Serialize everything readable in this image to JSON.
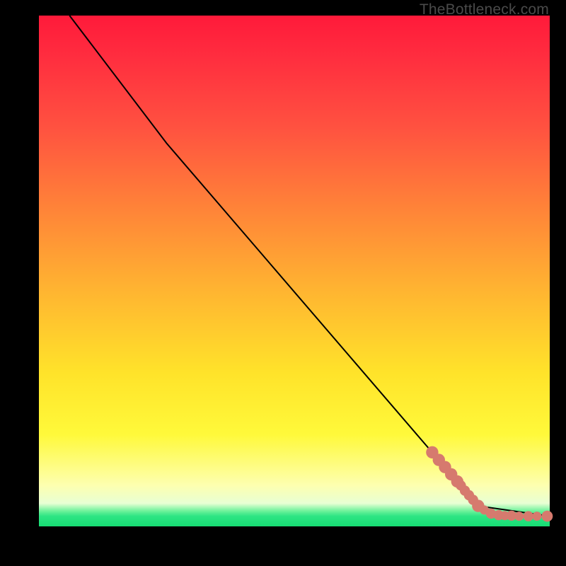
{
  "watermark": "TheBottleneck.com",
  "colors": {
    "gradient_top": "#ff1a3a",
    "gradient_mid": "#ffe32a",
    "gradient_bottom": "#17dd74",
    "curve": "#000000",
    "marker": "#d67a6e",
    "frame": "#000000"
  },
  "chart_data": {
    "type": "line",
    "title": "",
    "xlabel": "",
    "ylabel": "",
    "xlim": [
      0,
      100
    ],
    "ylim": [
      0,
      100
    ],
    "axes_visible": false,
    "curve": [
      {
        "x": 6,
        "y": 100
      },
      {
        "x": 25,
        "y": 75
      },
      {
        "x": 86,
        "y": 4
      },
      {
        "x": 100,
        "y": 2
      }
    ],
    "markers": [
      {
        "x": 77.0,
        "y": 14.5,
        "r": 1.2
      },
      {
        "x": 78.3,
        "y": 13.0,
        "r": 1.2
      },
      {
        "x": 79.5,
        "y": 11.6,
        "r": 1.2
      },
      {
        "x": 80.7,
        "y": 10.2,
        "r": 1.2
      },
      {
        "x": 81.9,
        "y": 8.8,
        "r": 1.2
      },
      {
        "x": 82.6,
        "y": 8.0,
        "r": 1.0
      },
      {
        "x": 83.4,
        "y": 7.0,
        "r": 1.0
      },
      {
        "x": 84.2,
        "y": 6.1,
        "r": 1.0
      },
      {
        "x": 85.0,
        "y": 5.2,
        "r": 1.0
      },
      {
        "x": 86.0,
        "y": 4.0,
        "r": 1.2
      },
      {
        "x": 87.2,
        "y": 3.2,
        "r": 0.9
      },
      {
        "x": 88.5,
        "y": 2.5,
        "r": 1.0
      },
      {
        "x": 90.0,
        "y": 2.2,
        "r": 1.0
      },
      {
        "x": 91.2,
        "y": 2.1,
        "r": 0.9
      },
      {
        "x": 92.5,
        "y": 2.1,
        "r": 1.0
      },
      {
        "x": 94.0,
        "y": 2.0,
        "r": 0.9
      },
      {
        "x": 95.8,
        "y": 2.0,
        "r": 1.0
      },
      {
        "x": 97.5,
        "y": 2.0,
        "r": 0.9
      },
      {
        "x": 99.5,
        "y": 2.0,
        "r": 1.1
      }
    ]
  }
}
